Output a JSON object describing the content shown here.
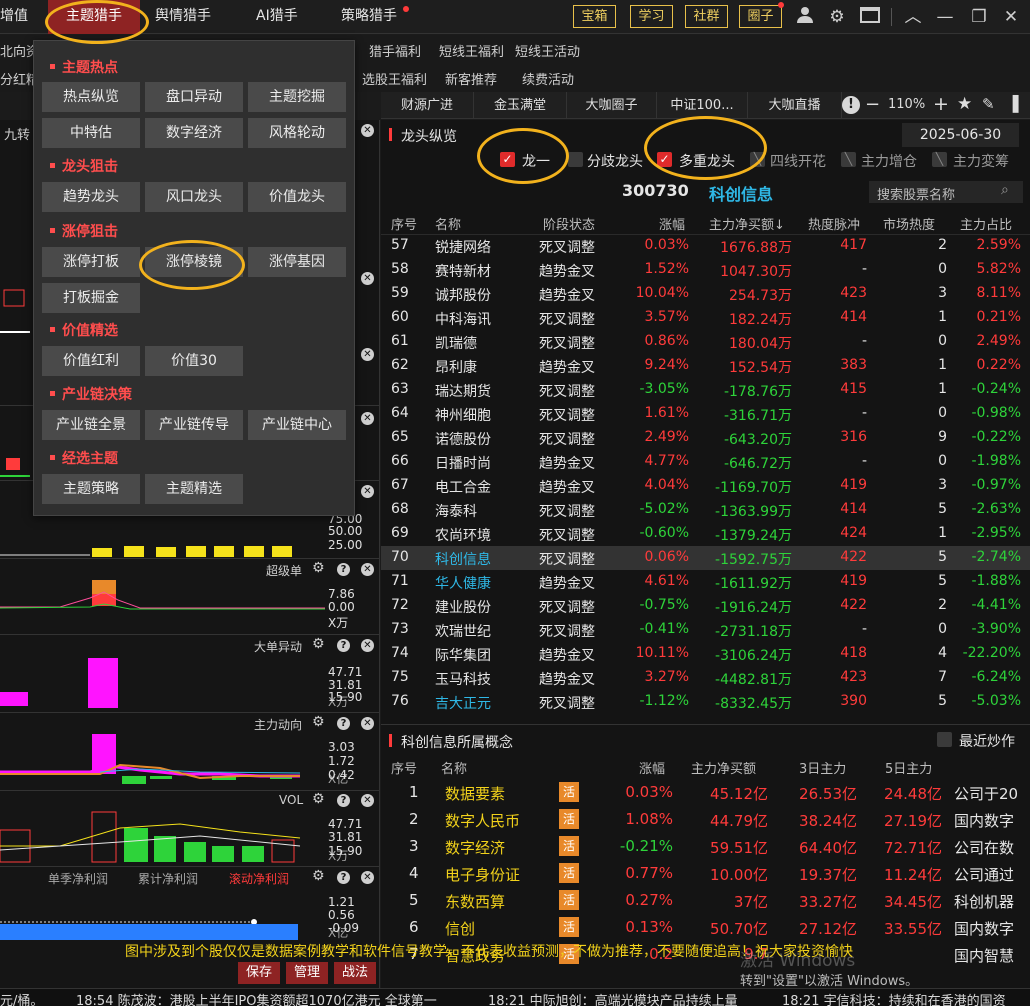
{
  "top_nav": {
    "left_cut": "增值",
    "theme_hunter": "主题猎手",
    "sentiment_hunter": "舆情猎手",
    "ai_hunter": "AI猎手",
    "strategy_hunter": "策略猎手",
    "buttons": [
      "宝箱",
      "学习",
      "社群",
      "圈子"
    ]
  },
  "row2": [
    "北向资",
    "猎手福利",
    "短线王福利",
    "短线王活动"
  ],
  "row3": [
    "分红精",
    "选股王福利",
    "新客推荐",
    "续费活动"
  ],
  "tabs3": [
    "财源广进",
    "金玉满堂",
    "大咖圈子",
    "中证100...",
    "大咖直播"
  ],
  "zoom": "110%",
  "left_cut_title": "九转",
  "menu": {
    "sections": [
      {
        "title": "主题热点",
        "items": [
          "热点纵览",
          "盘口异动",
          "主题挖掘",
          "中特估",
          "数字经济",
          "风格轮动"
        ]
      },
      {
        "title": "龙头狙击",
        "items": [
          "趋势龙头",
          "风口龙头",
          "价值龙头"
        ]
      },
      {
        "title": "涨停狙击",
        "items": [
          "涨停打板",
          "涨停棱镜",
          "涨停基因",
          "打板掘金"
        ]
      },
      {
        "title": "价值精选",
        "items": [
          "价值红利",
          "价值30"
        ]
      },
      {
        "title": "产业链决策",
        "items": [
          "产业链全景",
          "产业链传导",
          "产业链中心"
        ]
      },
      {
        "title": "经选主题",
        "items": [
          "主题策略",
          "主题精选"
        ]
      }
    ]
  },
  "left_indicators": {
    "vol_ticks": [
      "75.00",
      "50.00",
      "25.00"
    ],
    "superorder": {
      "label": "超级单",
      "ticks": [
        "7.86",
        "0.00"
      ],
      "cut": "X万"
    },
    "bigorder": {
      "label": "大单异动",
      "ticks": [
        "47.71",
        "31.81",
        "15.90"
      ],
      "cut": "X万"
    },
    "mainflow": {
      "label": "主力动向",
      "ticks": [
        "3.03",
        "1.72",
        "0.42"
      ],
      "cut": "X亿"
    },
    "vol": {
      "label": "VOL",
      "ticks": [
        "47.71",
        "31.81",
        "15.90"
      ],
      "cut": "X万"
    },
    "profit_tabs": [
      "单季净利润",
      "累计净利润",
      "滚动净利润"
    ],
    "profit_ticks": [
      "1.21",
      "0.56",
      "-0.09"
    ],
    "profit_cut": "X亿"
  },
  "dragon": {
    "title": "龙头纵览",
    "date": "2025-06-30",
    "filters": [
      {
        "label": "龙一",
        "checked": true
      },
      {
        "label": "分歧龙头",
        "checked": false
      },
      {
        "label": "多重龙头",
        "checked": true
      },
      {
        "label": "四线开花",
        "checked": false
      },
      {
        "label": "主力增仓",
        "checked": false
      },
      {
        "label": "主力変筹",
        "checked": false
      }
    ],
    "code": "300730",
    "name": "科创信息",
    "search_placeholder": "搜索股票名称",
    "headers": [
      "序号",
      "名称",
      "阶段状态",
      "涨幅",
      "主力净买额↓",
      "热度脉冲",
      "市场热度",
      "主力占比"
    ],
    "rows": [
      [
        "57",
        "锐捷网络",
        "死叉调整",
        "0.03%",
        "1676.88万",
        "417",
        "2",
        "2.59%"
      ],
      [
        "58",
        "赛特新材",
        "趋势金叉",
        "1.52%",
        "1047.30万",
        "-",
        "0",
        "5.82%"
      ],
      [
        "59",
        "诚邦股份",
        "趋势金叉",
        "10.04%",
        "254.73万",
        "423",
        "3",
        "8.11%"
      ],
      [
        "60",
        "中科海讯",
        "死叉调整",
        "3.57%",
        "182.24万",
        "414",
        "1",
        "0.21%"
      ],
      [
        "61",
        "凯瑞德",
        "死叉调整",
        "0.86%",
        "180.04万",
        "-",
        "0",
        "2.49%"
      ],
      [
        "62",
        "昂利康",
        "趋势金叉",
        "9.24%",
        "152.54万",
        "383",
        "1",
        "0.22%"
      ],
      [
        "63",
        "瑞达期货",
        "死叉调整",
        "-3.05%",
        "-178.76万",
        "415",
        "1",
        "-0.24%"
      ],
      [
        "64",
        "神州细胞",
        "死叉调整",
        "1.61%",
        "-316.71万",
        "-",
        "0",
        "-0.98%"
      ],
      [
        "65",
        "诺德股份",
        "死叉调整",
        "2.49%",
        "-643.20万",
        "316",
        "9",
        "-0.22%"
      ],
      [
        "66",
        "日播时尚",
        "趋势金叉",
        "4.77%",
        "-646.72万",
        "-",
        "0",
        "-1.98%"
      ],
      [
        "67",
        "电工合金",
        "趋势金叉",
        "4.04%",
        "-1169.70万",
        "419",
        "3",
        "-0.97%"
      ],
      [
        "68",
        "海泰科",
        "死叉调整",
        "-5.02%",
        "-1363.99万",
        "414",
        "5",
        "-2.63%"
      ],
      [
        "69",
        "农尚环境",
        "死叉调整",
        "-0.60%",
        "-1379.24万",
        "424",
        "1",
        "-2.95%"
      ],
      [
        "70",
        "科创信息",
        "死叉调整",
        "0.06%",
        "-1592.75万",
        "422",
        "5",
        "-2.74%"
      ],
      [
        "71",
        "华人健康",
        "趋势金叉",
        "4.61%",
        "-1611.92万",
        "419",
        "5",
        "-1.88%"
      ],
      [
        "72",
        "建业股份",
        "死叉调整",
        "-0.75%",
        "-1916.24万",
        "422",
        "2",
        "-4.41%"
      ],
      [
        "73",
        "欢瑞世纪",
        "死叉调整",
        "-0.41%",
        "-2731.18万",
        "-",
        "0",
        "-3.90%"
      ],
      [
        "74",
        "际华集团",
        "趋势金叉",
        "10.11%",
        "-3106.24万",
        "418",
        "4",
        "-22.20%"
      ],
      [
        "75",
        "玉马科技",
        "趋势金叉",
        "3.27%",
        "-4482.81万",
        "423",
        "7",
        "-6.24%"
      ],
      [
        "76",
        "吉大正元",
        "死叉调整",
        "-1.12%",
        "-8332.45万",
        "390",
        "5",
        "-5.03%"
      ]
    ],
    "cyan_rows": [
      13,
      14,
      19
    ]
  },
  "concept": {
    "title": "科创信息所属概念",
    "recent_label": "最近炒作",
    "headers": [
      "序号",
      "名称",
      "涨幅",
      "主力净买额",
      "3日主力",
      "5日主力"
    ],
    "tag": "活",
    "rows": [
      [
        "1",
        "数据要素",
        "0.03%",
        "45.12亿",
        "26.53亿",
        "24.48亿",
        "公司于20"
      ],
      [
        "2",
        "数字人民币",
        "1.08%",
        "44.79亿",
        "38.24亿",
        "27.19亿",
        "国内数字"
      ],
      [
        "3",
        "数字经济",
        "-0.21%",
        "59.51亿",
        "64.40亿",
        "72.71亿",
        "公司在数"
      ],
      [
        "4",
        "电子身份证",
        "0.77%",
        "10.00亿",
        "19.37亿",
        "11.24亿",
        "公司通过"
      ],
      [
        "5",
        "东数西算",
        "0.27%",
        "37亿",
        "33.27亿",
        "34.45亿",
        "科创机器"
      ],
      [
        "6",
        "信创",
        "0.13%",
        "50.70亿",
        "27.12亿",
        "33.55亿",
        "国内数字"
      ],
      [
        "7",
        "智慧政务",
        "0.2",
        "9.7",
        "",
        "",
        "国内智慧"
      ]
    ]
  },
  "disclaimer": "图中涉及到个股仅仅是数据案例教学和软件信号教学，不代表收益预测，不做为推荐，不要随便追高！祝大家投资愉快",
  "watermark": [
    "激活 Windows",
    "转到\"设置\"以激活 Windows。"
  ],
  "bottom_buttons": [
    "保存",
    "管理",
    "战法"
  ],
  "ticker": [
    "元/桶。",
    "18:54 陈茂波：港股上半年IPO集资额超1070亿港元 全球第一",
    "18:21 中际旭创：高端光模块产品持续上量",
    "18:21 宇信科技：持续和在香港的国资"
  ],
  "colors": {
    "accent_red": "#8e2323",
    "up": "#ff3b3b",
    "down": "#2ed33a",
    "highlight": "#f2b21d",
    "link": "#2fb8e6"
  }
}
